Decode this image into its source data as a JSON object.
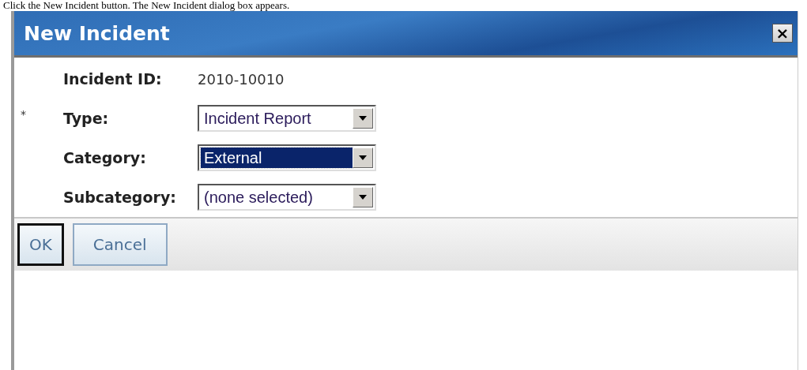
{
  "caption": "Click the New Incident button. The New Incident dialog box appears.",
  "window": {
    "title": "New Incident",
    "close_label": "×"
  },
  "fields": [
    {
      "kind": "text",
      "label": "Incident ID:",
      "value": "2010-10010"
    },
    {
      "kind": "select",
      "label": "Type:",
      "value": "Incident Report",
      "required_mark": "*",
      "focused": false
    },
    {
      "kind": "select",
      "label": "Category:",
      "value": "External",
      "focused": true
    },
    {
      "kind": "select",
      "label": "Subcategory:",
      "value": "(none selected)",
      "focused": false
    }
  ],
  "buttons": [
    {
      "label": "OK",
      "default": true
    },
    {
      "label": "Cancel",
      "default": false
    }
  ]
}
